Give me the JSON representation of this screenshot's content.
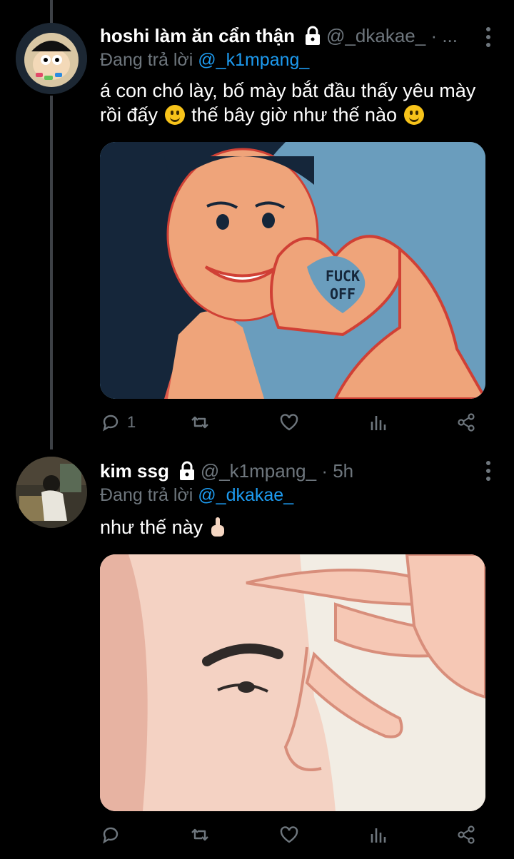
{
  "tweets": [
    {
      "display_name": "hoshi làm ăn cẩn thận",
      "handle": "@_dkakae_ · ...",
      "replying_prefix": "Đang trả lời",
      "replying_to": "@_k1mpang_",
      "text_line1": "á con chó lày, bố mày bắt đầu thấy yêu mày",
      "text_line2_a": "rồi đấy",
      "text_line2_b": "thế bây giờ như thế nào",
      "media_text_1": "FUCK",
      "media_text_2": "OFF",
      "reply_count": "1"
    },
    {
      "display_name": "kim ssg",
      "handle": "@_k1mpang_ · 5h",
      "replying_prefix": "Đang trả lời",
      "replying_to": "@_dkakae_",
      "text": "như thế này",
      "reply_count": ""
    }
  ],
  "icons": {
    "lock": "lock-icon",
    "more": "more-vertical-icon",
    "reply": "reply-icon",
    "retweet": "retweet-icon",
    "like": "heart-icon",
    "stats": "stats-icon",
    "share": "share-icon"
  },
  "colors": {
    "background": "#000000",
    "text_primary": "#ffffff",
    "text_secondary": "#6e767d",
    "link": "#1d9bf0",
    "thread_line": "#3d4146"
  }
}
